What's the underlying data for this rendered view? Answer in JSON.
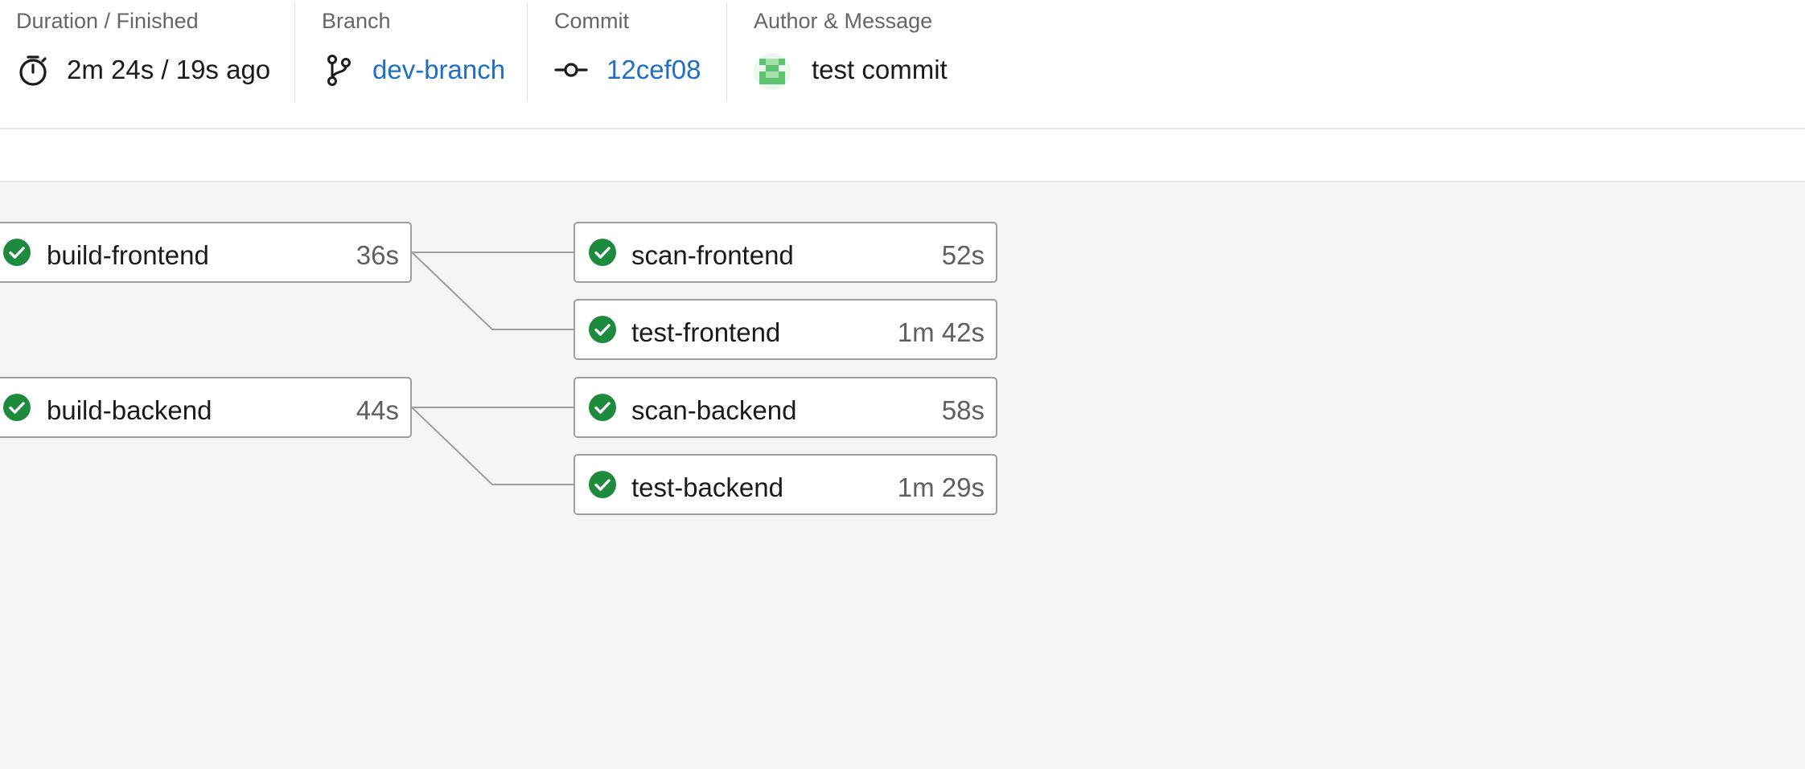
{
  "header": {
    "duration": {
      "label": "Duration / Finished",
      "icon": "stopwatch-icon",
      "value": "2m 24s / 19s ago"
    },
    "branch": {
      "label": "Branch",
      "icon": "branch-icon",
      "value": "dev-branch"
    },
    "commit": {
      "label": "Commit",
      "icon": "commit-icon",
      "value": "12cef08"
    },
    "author": {
      "label": "Author & Message",
      "icon": "avatar-identicon",
      "message": "test commit"
    }
  },
  "pipeline": {
    "status_icon": "success-check-icon",
    "colors": {
      "success": "#1e8a3e",
      "link": "#1f6fc5",
      "avatar": "#5cc46e"
    },
    "jobs": [
      {
        "name": "build-frontend",
        "duration": "36s",
        "status": "success"
      },
      {
        "name": "scan-frontend",
        "duration": "52s",
        "status": "success"
      },
      {
        "name": "test-frontend",
        "duration": "1m 42s",
        "status": "success"
      },
      {
        "name": "build-backend",
        "duration": "44s",
        "status": "success"
      },
      {
        "name": "scan-backend",
        "duration": "58s",
        "status": "success"
      },
      {
        "name": "test-backend",
        "duration": "1m 29s",
        "status": "success"
      }
    ],
    "dependencies": [
      [
        "build-frontend",
        "scan-frontend"
      ],
      [
        "build-frontend",
        "test-frontend"
      ],
      [
        "build-backend",
        "scan-backend"
      ],
      [
        "build-backend",
        "test-backend"
      ]
    ]
  }
}
